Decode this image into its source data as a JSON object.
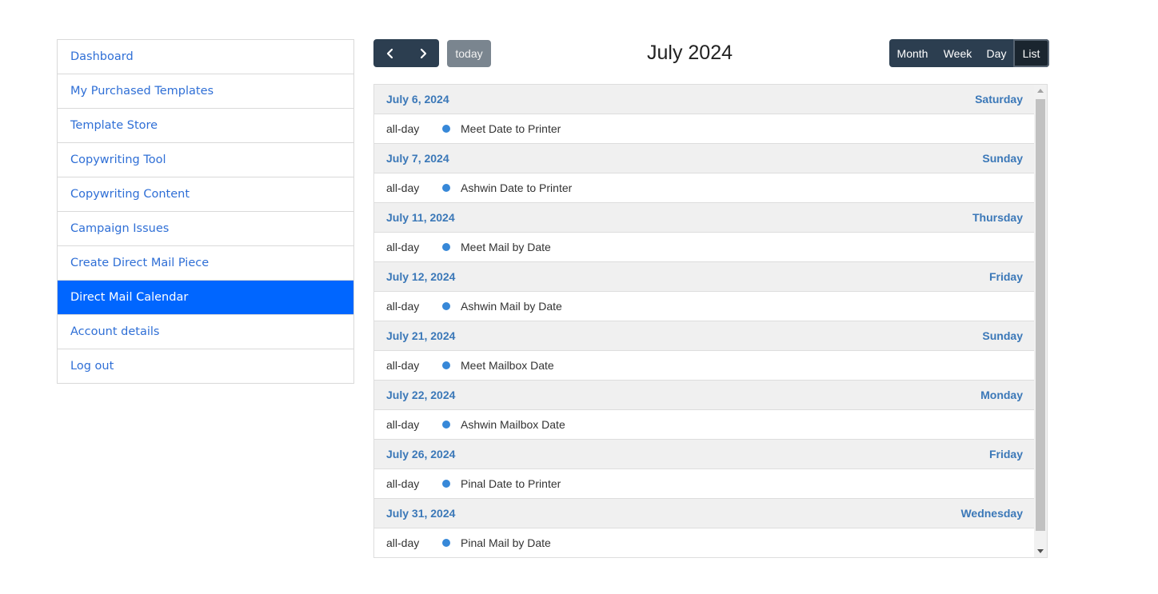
{
  "sidebar": {
    "items": [
      {
        "label": "Dashboard",
        "active": false
      },
      {
        "label": "My Purchased Templates",
        "active": false
      },
      {
        "label": "Template Store",
        "active": false
      },
      {
        "label": "Copywriting Tool",
        "active": false
      },
      {
        "label": "Copywriting Content",
        "active": false
      },
      {
        "label": "Campaign Issues",
        "active": false
      },
      {
        "label": "Create Direct Mail Piece",
        "active": false
      },
      {
        "label": "Direct Mail Calendar",
        "active": true
      },
      {
        "label": "Account details",
        "active": false
      },
      {
        "label": "Log out",
        "active": false
      }
    ],
    "active_color": "#0066ff",
    "link_color": "#2f6fd6"
  },
  "toolbar": {
    "prev_icon": "chevron-left-icon",
    "next_icon": "chevron-right-icon",
    "today_label": "today",
    "title": "July 2024",
    "views": [
      {
        "label": "Month",
        "active": false
      },
      {
        "label": "Week",
        "active": false
      },
      {
        "label": "Day",
        "active": false
      },
      {
        "label": "List",
        "active": true
      }
    ]
  },
  "list": {
    "event_color": "#3788d8",
    "days": [
      {
        "date": "July 6, 2024",
        "weekday": "Saturday",
        "events": [
          {
            "time": "all-day",
            "title": "Meet Date to Printer"
          }
        ]
      },
      {
        "date": "July 7, 2024",
        "weekday": "Sunday",
        "events": [
          {
            "time": "all-day",
            "title": "Ashwin Date to Printer"
          }
        ]
      },
      {
        "date": "July 11, 2024",
        "weekday": "Thursday",
        "events": [
          {
            "time": "all-day",
            "title": "Meet Mail by Date"
          }
        ]
      },
      {
        "date": "July 12, 2024",
        "weekday": "Friday",
        "events": [
          {
            "time": "all-day",
            "title": "Ashwin Mail by Date"
          }
        ]
      },
      {
        "date": "July 21, 2024",
        "weekday": "Sunday",
        "events": [
          {
            "time": "all-day",
            "title": "Meet Mailbox Date"
          }
        ]
      },
      {
        "date": "July 22, 2024",
        "weekday": "Monday",
        "events": [
          {
            "time": "all-day",
            "title": "Ashwin Mailbox Date"
          }
        ]
      },
      {
        "date": "July 26, 2024",
        "weekday": "Friday",
        "events": [
          {
            "time": "all-day",
            "title": "Pinal Date to Printer"
          }
        ]
      },
      {
        "date": "July 31, 2024",
        "weekday": "Wednesday",
        "events": [
          {
            "time": "all-day",
            "title": "Pinal Mail by Date"
          }
        ]
      }
    ]
  }
}
